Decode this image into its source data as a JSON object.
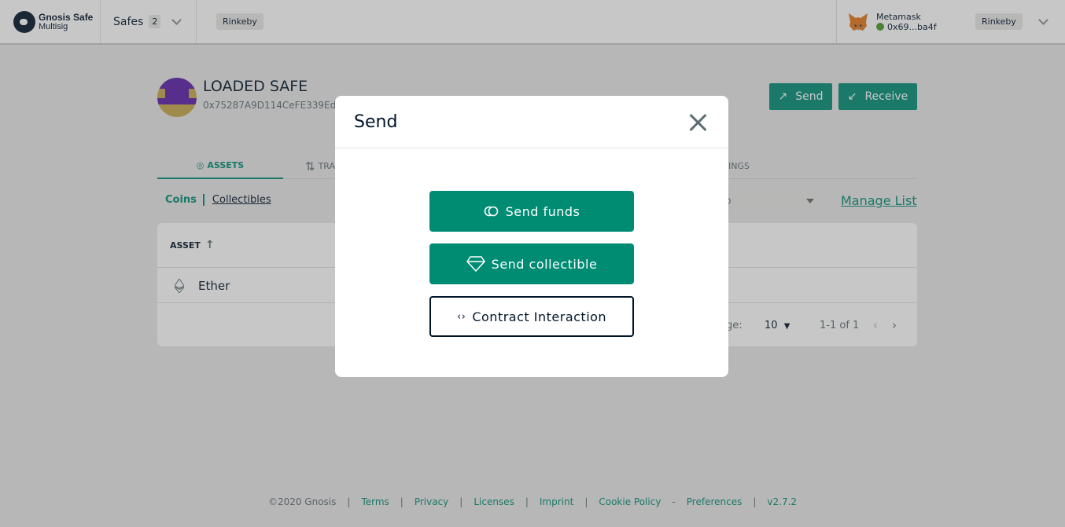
{
  "header": {
    "logo_line1": "Gnosis Safe",
    "logo_line2": "Multisig",
    "safes_label": "Safes",
    "safes_count": "2",
    "network": "Rinkeby",
    "wallet_name": "Metamask",
    "wallet_address": "0x69...ba4f",
    "wallet_network": "Rinkeby"
  },
  "safe": {
    "name": "LOADED SAFE",
    "address": "0x75287A9D114CeFE339Ed",
    "send_label": "Send",
    "receive_label": "Receive"
  },
  "tabs": {
    "assets": "ASSETS",
    "transactions": "TRA",
    "settings": "INGS"
  },
  "assets": {
    "coins": "Coins",
    "collectibles": "Collectibles",
    "currency": "D",
    "manage_list": "Manage List",
    "column_asset": "ASSET",
    "row_ether": "Ether",
    "rows_per_page_label": "ge:",
    "rows_per_page": "10",
    "pagination": "1-1 of 1"
  },
  "footer": {
    "copyright": "©2020 Gnosis",
    "sep": "|",
    "dash": "-",
    "terms": "Terms",
    "privacy": "Privacy",
    "licenses": "Licenses",
    "imprint": "Imprint",
    "cookie_policy": "Cookie Policy",
    "preferences": "Preferences",
    "version": "v2.7.2"
  },
  "modal": {
    "title": "Send",
    "send_funds": "Send funds",
    "send_collectible": "Send collectible",
    "contract_interaction": "Contract Interaction"
  },
  "colors": {
    "primary": "#008c73",
    "text": "#001428",
    "secondary_text": "#5d6d74"
  }
}
